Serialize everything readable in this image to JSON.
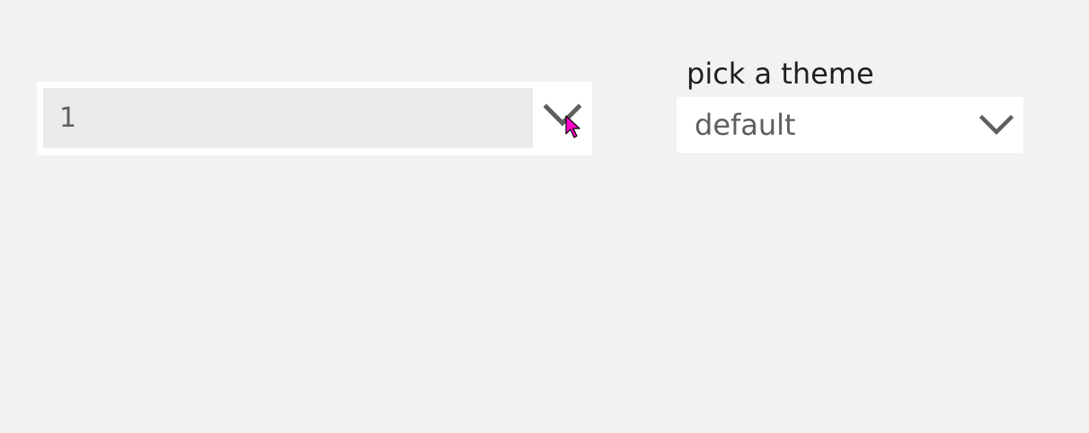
{
  "left_dropdown": {
    "value": "1",
    "icon": "chevron-down-icon"
  },
  "theme_picker": {
    "label": "pick a theme",
    "value": "default",
    "icon": "chevron-down-icon"
  },
  "colors": {
    "background": "#f3f2f1",
    "field_background": "#ffffff",
    "value_fill": "#edebe9",
    "text": "#201f1e",
    "muted_text": "#605e5c",
    "cursor": "#ff00cc"
  }
}
